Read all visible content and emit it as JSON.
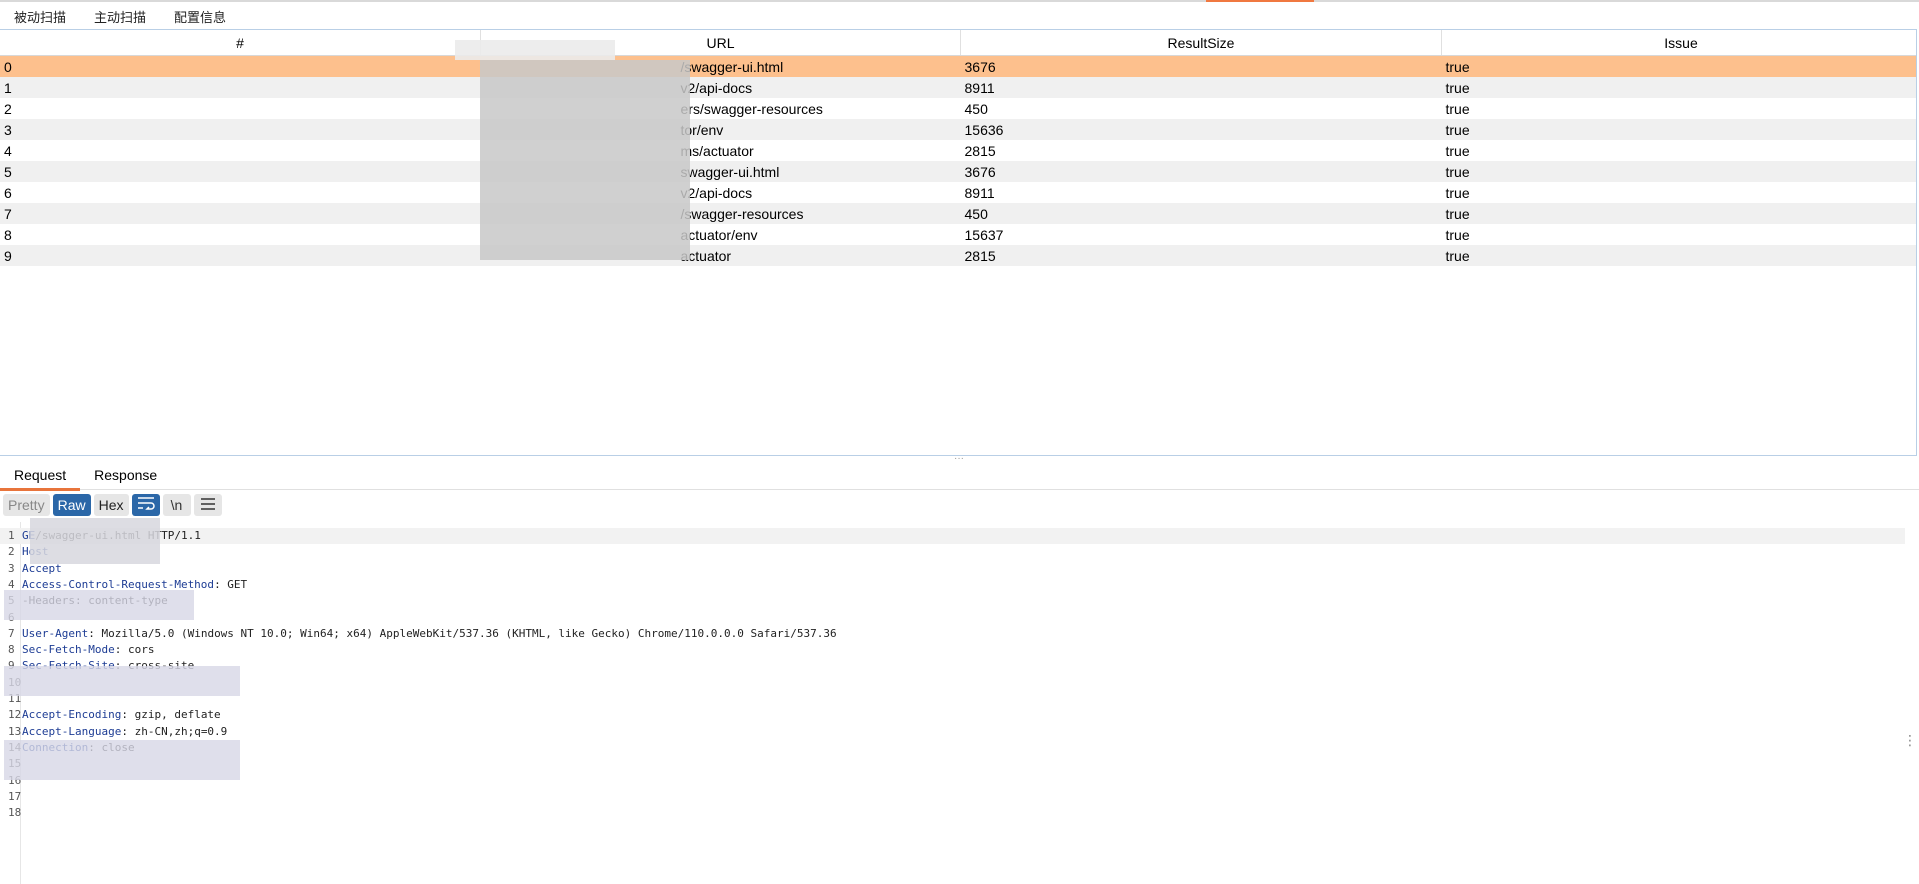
{
  "main_tabs": [
    "被动扫描",
    "主动扫描",
    "配置信息"
  ],
  "table": {
    "headers": [
      "#",
      "URL",
      "ResultSize",
      "Issue"
    ],
    "rows": [
      {
        "num": "0",
        "url": "/swagger-ui.html",
        "size": "3676",
        "issue": "true"
      },
      {
        "num": "1",
        "url": "v2/api-docs",
        "size": "8911",
        "issue": "true"
      },
      {
        "num": "2",
        "url": "ers/swagger-resources",
        "size": "450",
        "issue": "true"
      },
      {
        "num": "3",
        "url": "tor/env",
        "size": "15636",
        "issue": "true"
      },
      {
        "num": "4",
        "url": "ms/actuator",
        "size": "2815",
        "issue": "true"
      },
      {
        "num": "5",
        "url": "swagger-ui.html",
        "size": "3676",
        "issue": "true"
      },
      {
        "num": "6",
        "url": "v2/api-docs",
        "size": "8911",
        "issue": "true"
      },
      {
        "num": "7",
        "url": "/swagger-resources",
        "size": "450",
        "issue": "true"
      },
      {
        "num": "8",
        "url": "actuator/env",
        "size": "15637",
        "issue": "true"
      },
      {
        "num": "9",
        "url": "actuator",
        "size": "2815",
        "issue": "true"
      }
    ]
  },
  "detail_tabs": [
    "Request",
    "Response"
  ],
  "toolbar": {
    "pretty": "Pretty",
    "raw": "Raw",
    "hex": "Hex",
    "newline": "\\n"
  },
  "icons": {
    "wrap": "wrap-lines-icon",
    "menu": "hamburger-menu-icon"
  },
  "editor_lines": [
    {
      "n": "1",
      "key": "GE",
      "val": "/swagger-ui.html HTTP/1.1"
    },
    {
      "n": "2",
      "key": "Host",
      "val": ""
    },
    {
      "n": "3",
      "key": "Accept",
      "val": ""
    },
    {
      "n": "4",
      "key": "Access-Control-Request-Method",
      "val": ": GET"
    },
    {
      "n": "5",
      "key": "",
      "val": "-Headers: content-type"
    },
    {
      "n": "6",
      "key": "",
      "val": ""
    },
    {
      "n": "7",
      "key": "User-Agent",
      "val": ": Mozilla/5.0 (Windows NT 10.0; Win64; x64) AppleWebKit/537.36 (KHTML, like Gecko) Chrome/110.0.0.0 Safari/537.36"
    },
    {
      "n": "8",
      "key": "Sec-Fetch-Mode",
      "val": ": cors"
    },
    {
      "n": "9",
      "key": "Sec-Fetch-Site",
      "val": ": cross-site"
    },
    {
      "n": "10",
      "key": "",
      "val": ""
    },
    {
      "n": "11",
      "key": "",
      "val": ""
    },
    {
      "n": "12",
      "key": "Accept-Encoding",
      "val": ": gzip, deflate"
    },
    {
      "n": "13",
      "key": "Accept-Language",
      "val": ": zh-CN,zh;q=0.9"
    },
    {
      "n": "14",
      "key": "Connection",
      "val": ": close"
    },
    {
      "n": "15",
      "key": "",
      "val": ""
    },
    {
      "n": "16",
      "key": "",
      "val": ""
    },
    {
      "n": "17",
      "key": "",
      "val": ""
    },
    {
      "n": "18",
      "key": "",
      "val": ""
    }
  ],
  "colors": {
    "accent": "#e8743b",
    "selected_row": "#fdc08d",
    "raw_selected": "#2b67a8"
  }
}
